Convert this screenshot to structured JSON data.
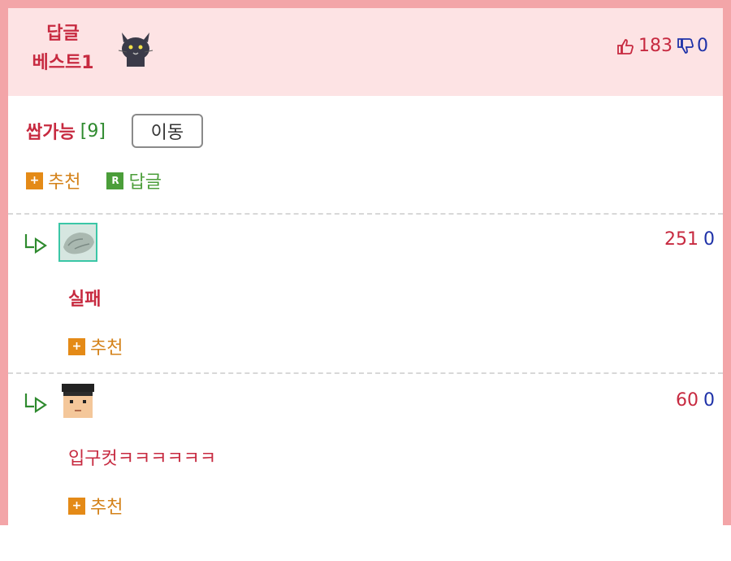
{
  "best": {
    "label_line1": "답글",
    "label_line2": "베스트1",
    "up_count": "183",
    "down_count": "0",
    "avatar_icon": "cat-avatar-icon"
  },
  "reply_info": {
    "label": "쌉가능",
    "count": "[9]",
    "move_button": "이동"
  },
  "actions": {
    "recommend_icon": "+",
    "recommend": "추천",
    "reply_icon": "R",
    "reply": "답글"
  },
  "comments": [
    {
      "up": "251",
      "down": "0",
      "text": "실패",
      "recommend_icon": "+",
      "recommend": "추천",
      "avatar_icon": "rock-avatar-icon"
    },
    {
      "up": "60",
      "down": "0",
      "text": "입구컷ㅋㅋㅋㅋㅋㅋ",
      "recommend_icon": "+",
      "recommend": "추천",
      "avatar_icon": "pixel-face-avatar-icon"
    }
  ],
  "colors": {
    "frame": "#f3a5a8",
    "header_bg": "#fde3e4",
    "accent_red": "#c72a40",
    "accent_blue": "#1f32a8",
    "accent_green": "#2e8a2e",
    "orange": "#e48a17"
  }
}
